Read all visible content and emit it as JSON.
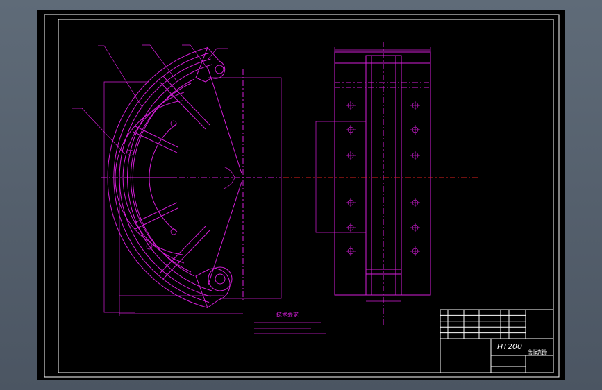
{
  "technical_requirements": {
    "title": "技术要求"
  },
  "title_block": {
    "material": "HT200",
    "part_name": "制动蹄"
  },
  "colors": {
    "background": "#000000",
    "outline": "#ffffff",
    "geometry": "#d41ed8",
    "centerline": "#e0211e",
    "viewport_frame": "#5a6572"
  }
}
